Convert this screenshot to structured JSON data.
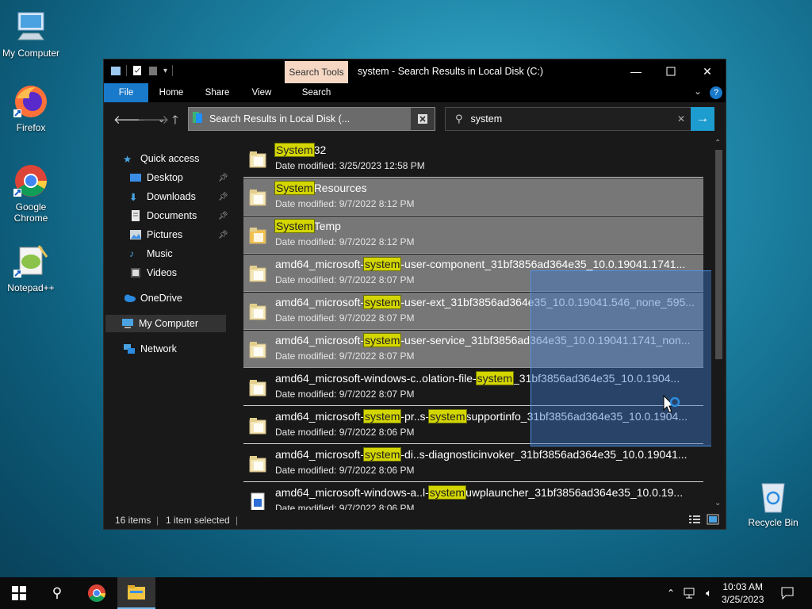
{
  "desktop": {
    "icons": [
      {
        "label": "My Computer"
      },
      {
        "label": "Firefox"
      },
      {
        "label": "Google Chrome"
      },
      {
        "label": "Notepad++"
      },
      {
        "label": "Recycle Bin"
      }
    ]
  },
  "window": {
    "context_tab": "Search Tools",
    "title": "system - Search Results in Local Disk (C:)",
    "ribbon_tabs": [
      "File",
      "Home",
      "Share",
      "View",
      "Search"
    ],
    "address": "Search Results in Local Disk (...",
    "search_value": "system",
    "sidebar": [
      {
        "label": "Quick access"
      },
      {
        "label": "Desktop"
      },
      {
        "label": "Downloads"
      },
      {
        "label": "Documents"
      },
      {
        "label": "Pictures"
      },
      {
        "label": "Music"
      },
      {
        "label": "Videos"
      },
      {
        "label": "OneDrive"
      },
      {
        "label": "My Computer"
      },
      {
        "label": "Network"
      }
    ],
    "results": [
      {
        "pre": "",
        "hl": "System",
        "post": "32",
        "date": "Date modified: 3/25/2023 12:58 PM"
      },
      {
        "pre": "",
        "hl": "System",
        "post": "Resources",
        "date": "Date modified: 9/7/2022 8:12 PM"
      },
      {
        "pre": "",
        "hl": "System",
        "post": "Temp",
        "date": "Date modified: 9/7/2022 8:12 PM"
      },
      {
        "pre": "amd64_microsoft-",
        "hl": "system",
        "post": "-user-component_31bf3856ad364e35_10.0.19041.1741...",
        "date": "Date modified: 9/7/2022 8:07 PM"
      },
      {
        "pre": "amd64_microsoft-",
        "hl": "system",
        "post": "-user-ext_31bf3856ad364e35_10.0.19041.546_none_595...",
        "date": "Date modified: 9/7/2022 8:07 PM"
      },
      {
        "pre": "amd64_microsoft-",
        "hl": "system",
        "post": "-user-service_31bf3856ad364e35_10.0.19041.1741_non...",
        "date": "Date modified: 9/7/2022 8:07 PM"
      },
      {
        "pre": "amd64_microsoft-windows-c..olation-file-",
        "hl": "system",
        "post": "_31bf3856ad364e35_10.0.1904...",
        "date": "Date modified: 9/7/2022 8:07 PM"
      },
      {
        "pre": "amd64_microsoft-",
        "hl": "system",
        "post": "-pr..s-",
        "hl2": "system",
        "post2": "supportinfo_31bf3856ad364e35_10.0.1904...",
        "date": "Date modified: 9/7/2022 8:06 PM"
      },
      {
        "pre": "amd64_microsoft-",
        "hl": "system",
        "post": "-di..s-diagnosticinvoker_31bf3856ad364e35_10.0.19041...",
        "date": "Date modified: 9/7/2022 8:06 PM"
      },
      {
        "pre": "amd64_microsoft-windows-a..l-",
        "hl": "system",
        "post": "uwplauncher_31bf3856ad364e35_10.0.19...",
        "date": "Date modified: 9/7/2022 8:06 PM"
      }
    ],
    "status_items": "16 items",
    "status_selected": "1 item selected"
  },
  "taskbar": {
    "time": "10:03 AM",
    "date": "3/25/2023"
  },
  "colors": {
    "accent": "#1979ca",
    "highlight": "#d4d600",
    "context_tab": "#f5d7c3"
  }
}
